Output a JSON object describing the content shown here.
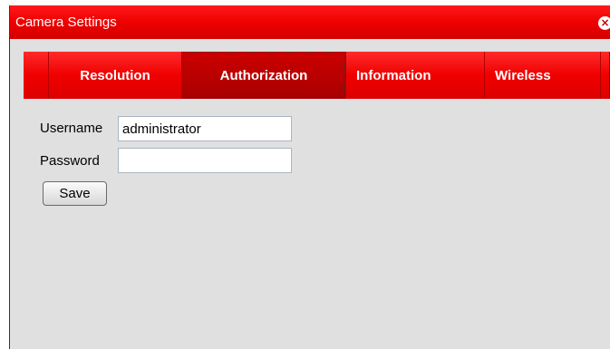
{
  "dialog": {
    "title": "Camera Settings",
    "close_icon": "close-circle-icon",
    "accent_color": "#e80000"
  },
  "tabs": [
    {
      "label": "Resolution",
      "active": false
    },
    {
      "label": "Authorization",
      "active": true
    },
    {
      "label": "Information",
      "active": false
    },
    {
      "label": "Wireless",
      "active": false
    }
  ],
  "form": {
    "username_label": "Username",
    "username_value": "administrator",
    "password_label": "Password",
    "password_value": "",
    "save_label": "Save"
  }
}
